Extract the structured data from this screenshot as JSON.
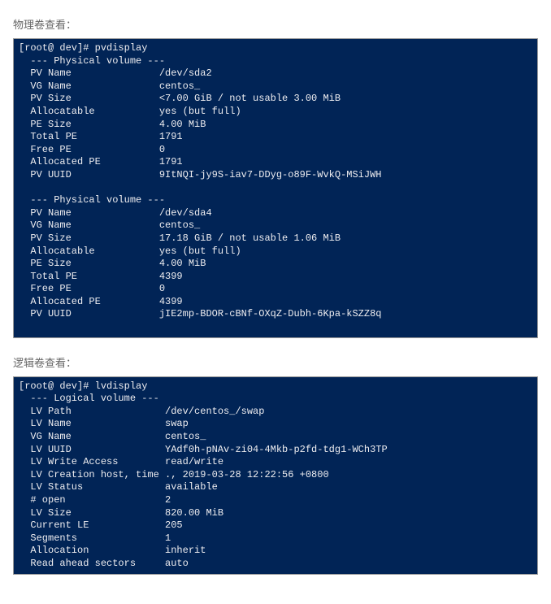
{
  "section1_label": "物理卷查看：",
  "section2_label": "逻辑卷查看：",
  "prompt_text": "[root@ dev]# ",
  "cmd_pv": "pvdisplay",
  "cmd_lv": "lvdisplay",
  "pv_header": "  --- Physical volume ---",
  "pv1": {
    "name": "  PV Name               /dev/sda2",
    "vgname": "  VG Name               centos_",
    "size": "  PV Size               <7.00 GiB / not usable 3.00 MiB",
    "alloc": "  Allocatable           yes (but full)",
    "pesize": "  PE Size               4.00 MiB",
    "totalpe": "  Total PE              1791",
    "freepe": "  Free PE               0",
    "allocpe": "  Allocated PE          1791",
    "uuid": "  PV UUID               9ItNQI-jy9S-iav7-DDyg-o89F-WvkQ-MSiJWH"
  },
  "pv2": {
    "name": "  PV Name               /dev/sda4",
    "vgname": "  VG Name               centos_",
    "size": "  PV Size               17.18 GiB / not usable 1.06 MiB",
    "alloc": "  Allocatable           yes (but full)",
    "pesize": "  PE Size               4.00 MiB",
    "totalpe": "  Total PE              4399",
    "freepe": "  Free PE               0",
    "allocpe": "  Allocated PE          4399",
    "uuid": "  PV UUID               jIE2mp-BDOR-cBNf-OXqZ-Dubh-6Kpa-kSZZ8q"
  },
  "lv_header": "  --- Logical volume ---",
  "lv": {
    "path": "  LV Path                /dev/centos_/swap",
    "name": "  LV Name                swap",
    "vgname": "  VG Name                centos_",
    "uuid": "  LV UUID                YAdf0h-pNAv-zi04-4Mkb-p2fd-tdg1-WCh3TP",
    "write": "  LV Write Access        read/write",
    "creation": "  LV Creation host, time ., 2019-03-28 12:22:56 +0800",
    "status": "  LV Status              available",
    "open": "  # open                 2",
    "size": "  LV Size                820.00 MiB",
    "curle": "  Current LE             205",
    "segments": "  Segments               1",
    "allocation": "  Allocation             inherit",
    "readahead": "  Read ahead sectors     auto"
  }
}
